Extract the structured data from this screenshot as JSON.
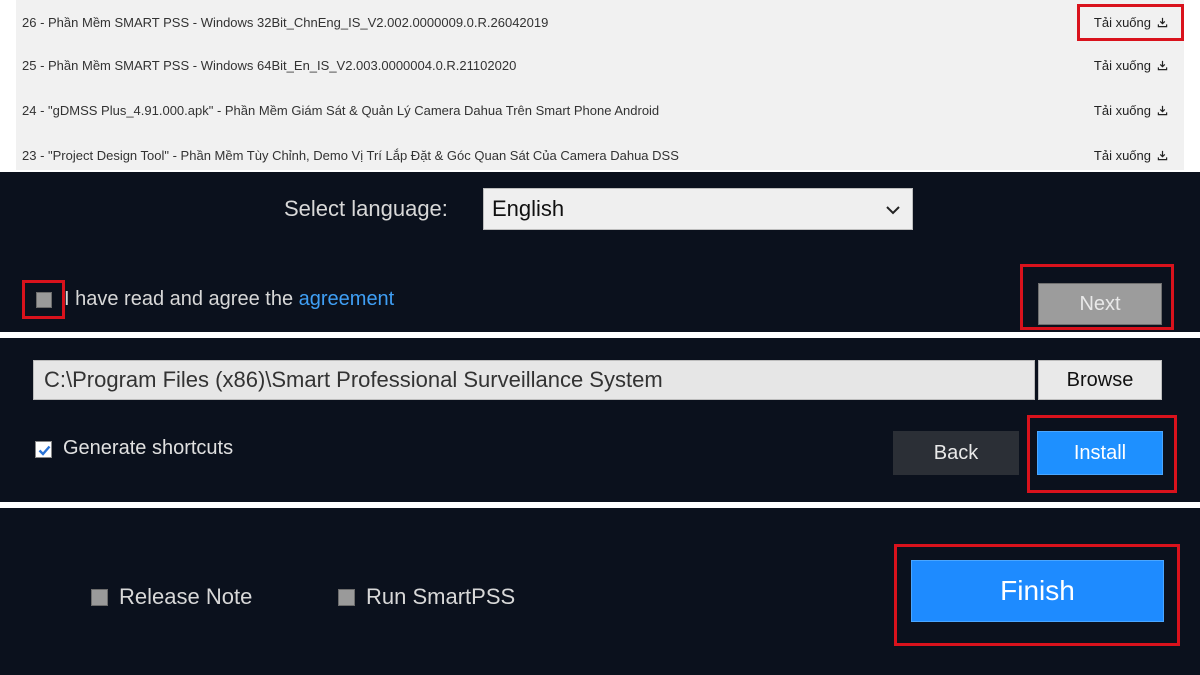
{
  "download_list": {
    "items": [
      {
        "name": "26 - Phần Mềm SMART PSS - Windows 32Bit_ChnEng_IS_V2.002.0000009.0.R.26042019",
        "action": "Tải xuống"
      },
      {
        "name": "25 - Phần Mềm SMART PSS - Windows 64Bit_En_IS_V2.003.0000004.0.R.21102020",
        "action": "Tải xuống"
      },
      {
        "name": "24 - \"gDMSS Plus_4.91.000.apk\" - Phần Mềm Giám Sát & Quản Lý Camera Dahua Trên Smart Phone Android",
        "action": "Tải xuống"
      },
      {
        "name": "23 - \"Project Design Tool\" - Phần Mềm Tùy Chỉnh, Demo Vị Trí Lắp Đặt & Góc Quan Sát Của Camera Dahua DSS",
        "action": "Tải xuống"
      }
    ],
    "icon": "download-icon"
  },
  "language_step": {
    "label": "Select language:",
    "selected": "English",
    "agree_prefix": "I have read and agree the ",
    "agree_link": "agreement",
    "agree_checked": false,
    "next_label": "Next"
  },
  "install_step": {
    "path": "C:\\Program Files (x86)\\Smart Professional Surveillance System",
    "browse_label": "Browse",
    "shortcuts_label": "Generate shortcuts",
    "shortcuts_checked": true,
    "back_label": "Back",
    "install_label": "Install"
  },
  "finish_step": {
    "release_note_label": "Release Note",
    "run_label": "Run SmartPSS",
    "finish_label": "Finish"
  },
  "colors": {
    "dark_bg": "#0b111d",
    "accent_blue": "#1e90ff",
    "highlight_red": "#d9121c",
    "link_blue": "#3f9ff5"
  }
}
